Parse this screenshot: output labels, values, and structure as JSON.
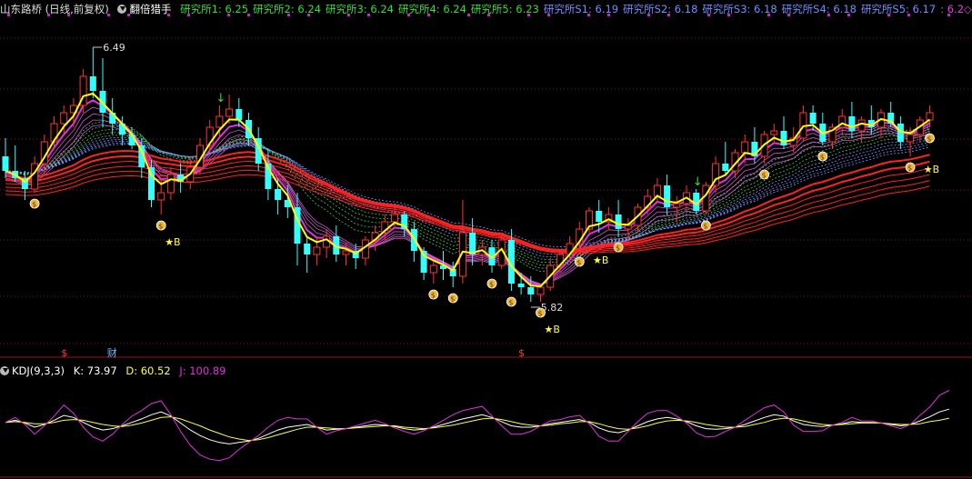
{
  "header": {
    "stock_title": "山东路桥 (日线,前复权)",
    "indicator_name": "翻倍猎手",
    "labels": [
      {
        "text": "研究所1: 6.25",
        "color": "#33dd33"
      },
      {
        "text": "研究所2: 6.24",
        "color": "#33dd33"
      },
      {
        "text": "研究所3: 6.24",
        "color": "#33dd33"
      },
      {
        "text": "研究所4: 6.24",
        "color": "#33dd33"
      },
      {
        "text": "研究所5: 6.23",
        "color": "#33dd33"
      },
      {
        "text": "研究所S1: 6.19",
        "color": "#6f8fff"
      },
      {
        "text": "研究所S2: 6.18",
        "color": "#6f8fff"
      },
      {
        "text": "研究所S3: 6.18",
        "color": "#6f8fff"
      },
      {
        "text": "研究所S4: 6.18",
        "color": "#6f8fff"
      },
      {
        "text": "研究所S5: 6.17",
        "color": "#6f8fff"
      },
      {
        "text": ": 6.2◇",
        "color": "#dd44dd"
      }
    ]
  },
  "kdj_header": {
    "name": "KDJ(9,3,3)",
    "k": "K: 73.97",
    "d": "D: 60.52",
    "j": "J: 100.89",
    "k_color": "#ffffff",
    "d_color": "#ffff33",
    "j_color": "#dd33dd"
  },
  "annotations": {
    "high_label": "6.49",
    "low_label": "5.82",
    "b_label": "★B",
    "dollar_marker": "$",
    "finance_marker": "财",
    "arrow_down": "↓"
  },
  "colors": {
    "up": "#ff3333",
    "down": "#33ffff",
    "yellow_line": "#ffff00",
    "magenta": "#ff33ff",
    "red_ribbon": "#ff2222",
    "grid": "#7a1a1a",
    "money_bag": "#e8b840"
  },
  "chart_data": [
    {
      "type": "candlestick",
      "title": "山东路桥 (日线,前复权)",
      "series_name": "daily candles",
      "ylim": [
        5.7,
        6.6
      ],
      "candles": [
        [
          6.22,
          6.27,
          6.16,
          6.18
        ],
        [
          6.18,
          6.25,
          6.15,
          6.16
        ],
        [
          6.16,
          6.18,
          6.1,
          6.13
        ],
        [
          6.13,
          6.22,
          6.12,
          6.2
        ],
        [
          6.2,
          6.28,
          6.17,
          6.26
        ],
        [
          6.26,
          6.33,
          6.24,
          6.31
        ],
        [
          6.31,
          6.36,
          6.28,
          6.34
        ],
        [
          6.34,
          6.38,
          6.3,
          6.36
        ],
        [
          6.36,
          6.46,
          6.34,
          6.44
        ],
        [
          6.44,
          6.52,
          6.38,
          6.4
        ],
        [
          6.4,
          6.49,
          6.3,
          6.34
        ],
        [
          6.34,
          6.38,
          6.28,
          6.31
        ],
        [
          6.31,
          6.33,
          6.25,
          6.28
        ],
        [
          6.28,
          6.3,
          6.24,
          6.25
        ],
        [
          6.25,
          6.27,
          6.16,
          6.19
        ],
        [
          6.19,
          6.21,
          6.08,
          6.1
        ],
        [
          6.1,
          6.16,
          6.06,
          6.12
        ],
        [
          6.12,
          6.19,
          6.1,
          6.17
        ],
        [
          6.17,
          6.2,
          6.12,
          6.15
        ],
        [
          6.15,
          6.22,
          6.13,
          6.19
        ],
        [
          6.19,
          6.27,
          6.17,
          6.25
        ],
        [
          6.25,
          6.32,
          6.23,
          6.3
        ],
        [
          6.3,
          6.36,
          6.27,
          6.33
        ],
        [
          6.33,
          6.39,
          6.31,
          6.35
        ],
        [
          6.35,
          6.38,
          6.3,
          6.32
        ],
        [
          6.32,
          6.34,
          6.25,
          6.27
        ],
        [
          6.27,
          6.3,
          6.18,
          6.2
        ],
        [
          6.2,
          6.24,
          6.1,
          6.13
        ],
        [
          6.13,
          6.16,
          6.06,
          6.1
        ],
        [
          6.1,
          6.14,
          6.05,
          6.08
        ],
        [
          6.08,
          6.12,
          5.92,
          5.98
        ],
        [
          5.98,
          6.0,
          5.9,
          5.95
        ],
        [
          5.95,
          6.0,
          5.92,
          5.97
        ],
        [
          5.97,
          6.02,
          5.94,
          6.0
        ],
        [
          6.0,
          6.03,
          5.93,
          5.95
        ],
        [
          5.95,
          5.98,
          5.92,
          5.96
        ],
        [
          5.96,
          5.98,
          5.91,
          5.94
        ],
        [
          5.94,
          6.0,
          5.92,
          5.99
        ],
        [
          5.99,
          6.03,
          5.96,
          6.01
        ],
        [
          6.01,
          6.06,
          5.99,
          6.04
        ],
        [
          6.04,
          6.08,
          6.02,
          6.06
        ],
        [
          6.06,
          6.07,
          6.0,
          6.02
        ],
        [
          6.02,
          6.04,
          5.93,
          5.96
        ],
        [
          5.96,
          5.97,
          5.88,
          5.9
        ],
        [
          5.9,
          5.94,
          5.87,
          5.92
        ],
        [
          5.92,
          5.96,
          5.88,
          5.91
        ],
        [
          5.91,
          5.93,
          5.86,
          5.89
        ],
        [
          5.89,
          6.1,
          5.87,
          6.01
        ],
        [
          6.01,
          6.05,
          5.92,
          5.95
        ],
        [
          5.95,
          5.99,
          5.92,
          5.97
        ],
        [
          5.97,
          5.99,
          5.9,
          5.92
        ],
        [
          5.92,
          6.0,
          5.91,
          5.99
        ],
        [
          5.99,
          6.02,
          5.85,
          5.87
        ],
        [
          5.87,
          5.9,
          5.84,
          5.86
        ],
        [
          5.86,
          5.89,
          5.82,
          5.84
        ],
        [
          5.84,
          5.87,
          5.82,
          5.86
        ],
        [
          5.86,
          5.94,
          5.85,
          5.92
        ],
        [
          5.92,
          5.96,
          5.9,
          5.95
        ],
        [
          5.95,
          6.0,
          5.93,
          5.98
        ],
        [
          5.98,
          6.04,
          5.96,
          6.02
        ],
        [
          6.02,
          6.08,
          6.01,
          6.07
        ],
        [
          6.07,
          6.1,
          6.01,
          6.04
        ],
        [
          6.04,
          6.08,
          6.02,
          6.06
        ],
        [
          6.06,
          6.1,
          6.0,
          6.02
        ],
        [
          6.02,
          6.05,
          5.98,
          6.03
        ],
        [
          6.03,
          6.09,
          6.01,
          6.08
        ],
        [
          6.08,
          6.13,
          6.06,
          6.11
        ],
        [
          6.11,
          6.16,
          6.09,
          6.14
        ],
        [
          6.14,
          6.17,
          6.06,
          6.08
        ],
        [
          6.08,
          6.11,
          6.04,
          6.09
        ],
        [
          6.09,
          6.14,
          6.07,
          6.12
        ],
        [
          6.12,
          6.13,
          6.06,
          6.07
        ],
        [
          6.07,
          6.15,
          6.06,
          6.14
        ],
        [
          6.14,
          6.22,
          6.12,
          6.2
        ],
        [
          6.2,
          6.26,
          6.17,
          6.18
        ],
        [
          6.18,
          6.24,
          6.16,
          6.23
        ],
        [
          6.23,
          6.28,
          6.2,
          6.26
        ],
        [
          6.26,
          6.3,
          6.2,
          6.22
        ],
        [
          6.22,
          6.29,
          6.2,
          6.28
        ],
        [
          6.28,
          6.31,
          6.26,
          6.29
        ],
        [
          6.29,
          6.33,
          6.24,
          6.25
        ],
        [
          6.25,
          6.3,
          6.23,
          6.27
        ],
        [
          6.27,
          6.36,
          6.26,
          6.34
        ],
        [
          6.34,
          6.36,
          6.29,
          6.31
        ],
        [
          6.31,
          6.34,
          6.25,
          6.26
        ],
        [
          6.26,
          6.31,
          6.24,
          6.3
        ],
        [
          6.3,
          6.35,
          6.28,
          6.33
        ],
        [
          6.33,
          6.37,
          6.27,
          6.29
        ],
        [
          6.29,
          6.33,
          6.26,
          6.32
        ],
        [
          6.32,
          6.36,
          6.28,
          6.3
        ],
        [
          6.3,
          6.35,
          6.27,
          6.34
        ],
        [
          6.34,
          6.37,
          6.3,
          6.31
        ],
        [
          6.31,
          6.33,
          6.24,
          6.26
        ],
        [
          6.26,
          6.3,
          6.22,
          6.28
        ],
        [
          6.28,
          6.33,
          6.26,
          6.32
        ],
        [
          6.32,
          6.36,
          6.3,
          6.34
        ]
      ]
    },
    {
      "type": "line",
      "title": "KDJ(9,3,3)",
      "ylim": [
        -20,
        120
      ],
      "series": [
        {
          "name": "K",
          "values": [
            55,
            58,
            54,
            48,
            52,
            58,
            65,
            62,
            55,
            48,
            44,
            46,
            50,
            55,
            60,
            66,
            70,
            64,
            54,
            44,
            36,
            30,
            26,
            24,
            26,
            28,
            32,
            38,
            44,
            48,
            50,
            52,
            48,
            44,
            45,
            46,
            48,
            50,
            52,
            51,
            49,
            46,
            44,
            45,
            48,
            52,
            56,
            60,
            63,
            66,
            62,
            56,
            50,
            48,
            48,
            50,
            53,
            55,
            57,
            59,
            55,
            47,
            42,
            40,
            44,
            50,
            56,
            60,
            62,
            60,
            56,
            50,
            46,
            45,
            46,
            48,
            52,
            57,
            62,
            66,
            64,
            57,
            52,
            50,
            49,
            51,
            53,
            56,
            55,
            55,
            54,
            52,
            50,
            52,
            57,
            63,
            70,
            74
          ]
        },
        {
          "name": "D",
          "values": [
            55,
            56,
            55,
            53,
            53,
            55,
            58,
            59,
            58,
            55,
            52,
            50,
            49,
            51,
            54,
            58,
            62,
            63,
            60,
            55,
            50,
            44,
            39,
            34,
            31,
            29,
            30,
            33,
            37,
            41,
            45,
            48,
            48,
            47,
            46,
            46,
            47,
            48,
            49,
            50,
            50,
            48,
            47,
            46,
            47,
            49,
            51,
            54,
            57,
            60,
            61,
            59,
            56,
            53,
            51,
            50,
            51,
            53,
            54,
            56,
            56,
            53,
            49,
            46,
            45,
            47,
            50,
            54,
            57,
            58,
            57,
            55,
            52,
            50,
            48,
            48,
            49,
            52,
            55,
            59,
            61,
            60,
            57,
            54,
            52,
            51,
            52,
            53,
            54,
            54,
            54,
            53,
            52,
            52,
            53,
            56,
            58,
            61
          ]
        },
        {
          "name": "J",
          "values": [
            55,
            62,
            52,
            38,
            50,
            64,
            80,
            68,
            48,
            34,
            28,
            38,
            52,
            64,
            72,
            82,
            86,
            66,
            42,
            22,
            8,
            2,
            0,
            4,
            16,
            26,
            36,
            48,
            58,
            62,
            60,
            60,
            48,
            38,
            43,
            46,
            50,
            54,
            58,
            53,
            47,
            42,
            38,
            43,
            50,
            58,
            66,
            72,
            75,
            78,
            64,
            50,
            38,
            38,
            42,
            50,
            57,
            59,
            63,
            65,
            53,
            35,
            28,
            28,
            42,
            56,
            68,
            72,
            72,
            64,
            54,
            40,
            34,
            35,
            42,
            48,
            58,
            67,
            76,
            80,
            70,
            51,
            42,
            42,
            43,
            51,
            55,
            62,
            57,
            57,
            54,
            50,
            46,
            52,
            65,
            77,
            94,
            101
          ]
        }
      ]
    }
  ]
}
